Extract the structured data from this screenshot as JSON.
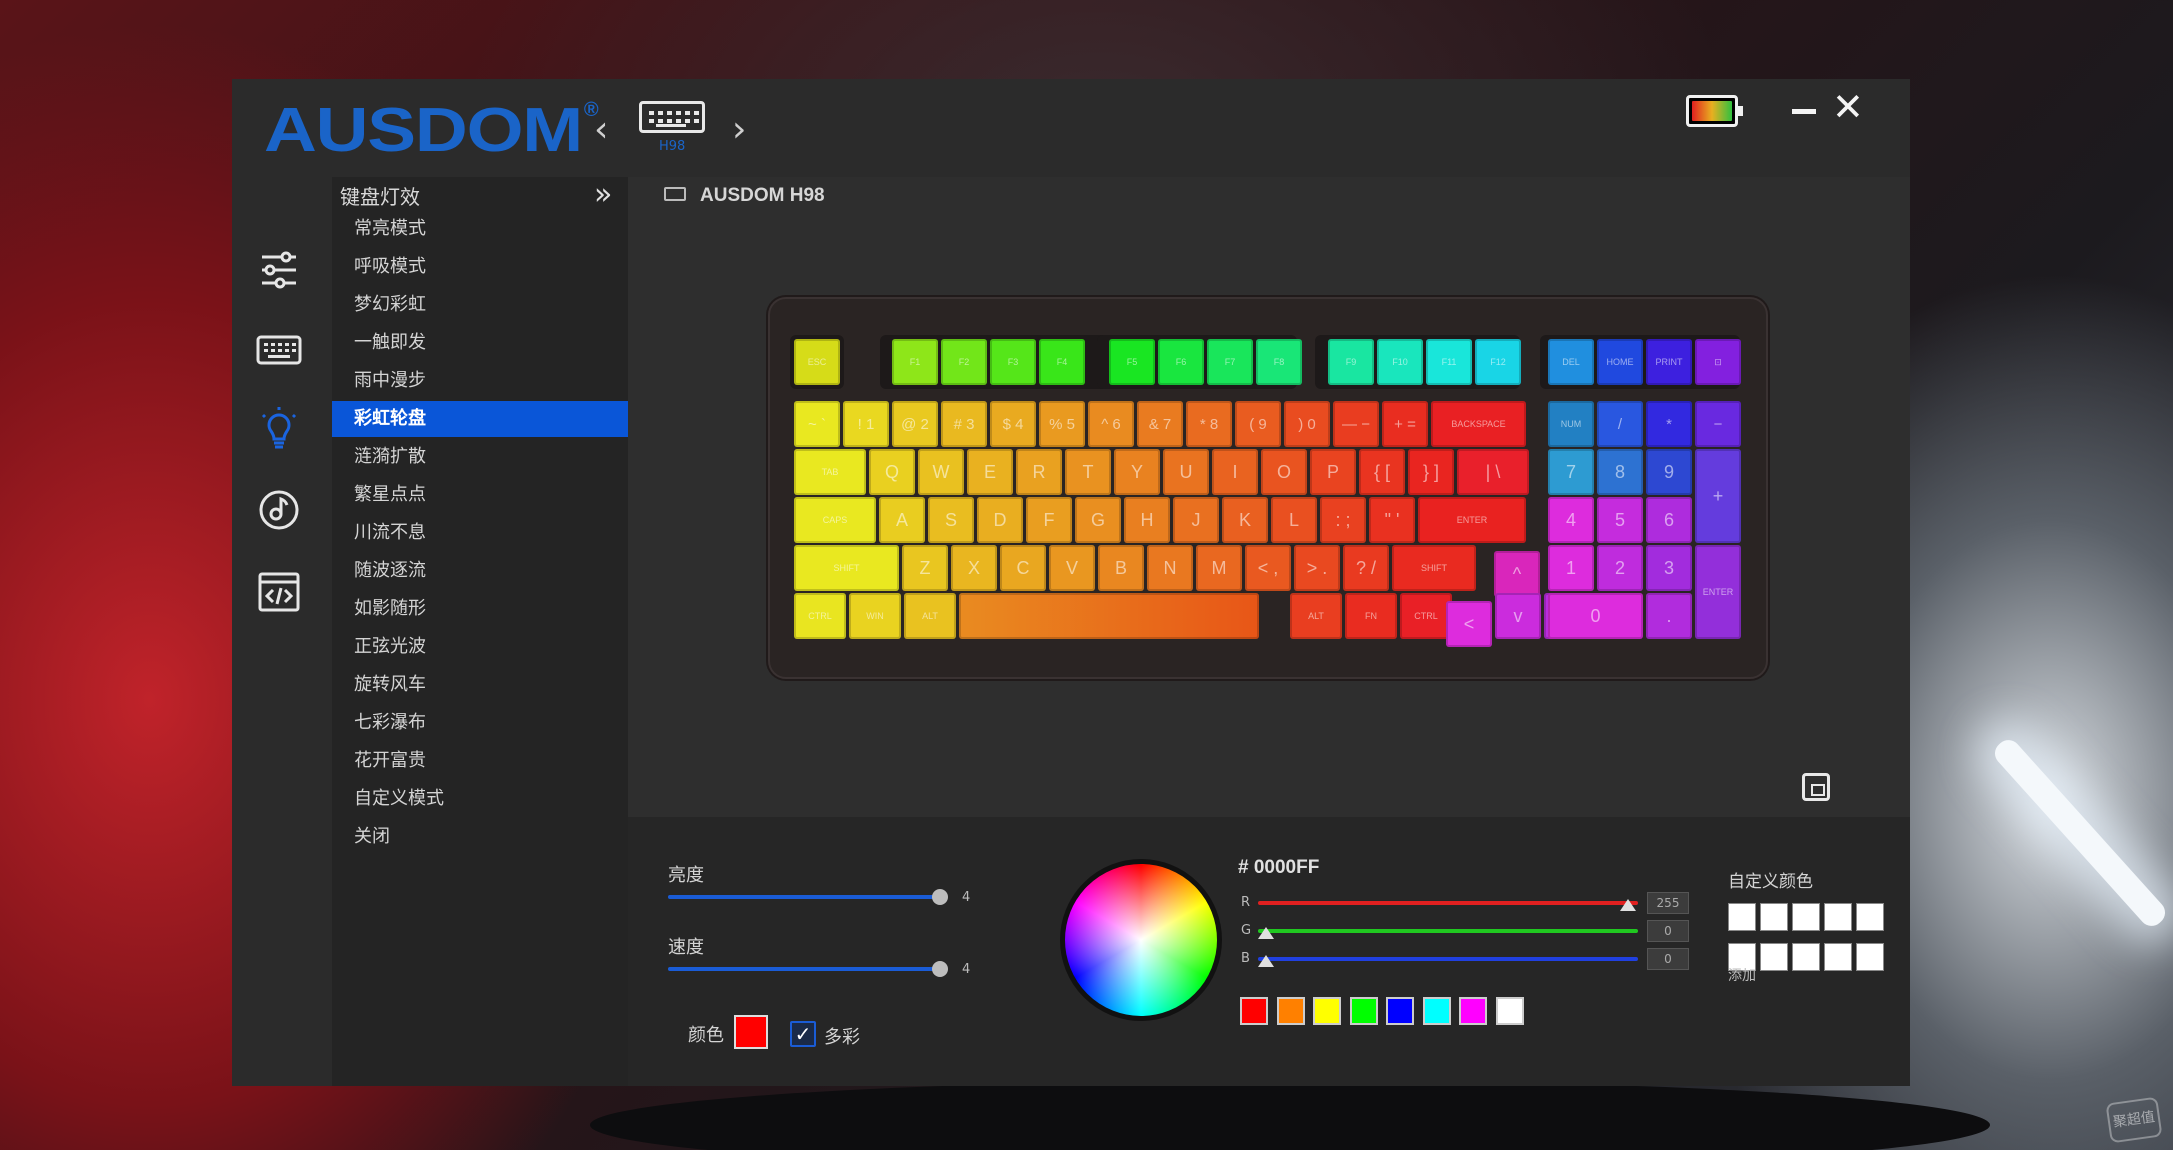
{
  "header": {
    "logo": "AUSDOM",
    "logo_mark": "®",
    "device_name": "H98",
    "prev_icon": "‹",
    "next_icon": "›",
    "minimize_label": "",
    "close_icon": "✕"
  },
  "sidebar_icons": [
    "sliders-icon",
    "keyboard-icon",
    "lightbulb-icon",
    "music-icon",
    "macro-code-icon"
  ],
  "menu": {
    "title": "键盘灯效",
    "collapse_icon": "»",
    "items": [
      {
        "label": "常亮模式"
      },
      {
        "label": "呼吸模式"
      },
      {
        "label": "梦幻彩虹"
      },
      {
        "label": "一触即发"
      },
      {
        "label": "雨中漫步"
      },
      {
        "label": "彩虹轮盘",
        "active": true
      },
      {
        "label": "涟漪扩散"
      },
      {
        "label": "繁星点点"
      },
      {
        "label": "川流不息"
      },
      {
        "label": "随波逐流"
      },
      {
        "label": "如影随形"
      },
      {
        "label": "正弦光波"
      },
      {
        "label": "旋转风车"
      },
      {
        "label": "七彩瀑布"
      },
      {
        "label": "花开富贵"
      },
      {
        "label": "自定义模式"
      },
      {
        "label": "关闭"
      }
    ]
  },
  "main": {
    "title": "AUSDOM H98"
  },
  "keyboard": {
    "row_f": [
      "ESC",
      "F1",
      "F2",
      "F3",
      "F4",
      "F5",
      "F6",
      "F7",
      "F8",
      "F9",
      "F10",
      "F11",
      "F12",
      "DEL",
      "HOME",
      "PRINT",
      "⊡"
    ],
    "row_1": [
      [
        "~",
        "`"
      ],
      [
        "!",
        "1"
      ],
      [
        "@",
        "2"
      ],
      [
        "#",
        "3"
      ],
      [
        "$",
        "4"
      ],
      [
        "%",
        "5"
      ],
      [
        "^",
        "6"
      ],
      [
        "&",
        "7"
      ],
      [
        "*",
        "8"
      ],
      [
        "(",
        "9"
      ],
      [
        ")",
        "0"
      ],
      [
        "—",
        "−"
      ],
      [
        "+",
        "="
      ],
      [
        "BACKSPACE",
        ""
      ],
      [
        "NUM",
        ""
      ],
      [
        "/",
        ""
      ],
      [
        "*",
        ""
      ],
      [
        "−",
        ""
      ]
    ],
    "row_2": [
      "TAB",
      "Q",
      "W",
      "E",
      "R",
      "T",
      "Y",
      "U",
      "I",
      "O",
      "P",
      "{ [",
      "} ]",
      "| \\",
      "7",
      "8",
      "9",
      "+"
    ],
    "row_3": [
      "CAPS",
      "A",
      "S",
      "D",
      "F",
      "G",
      "H",
      "J",
      "K",
      "L",
      ": ;",
      "\" '",
      "ENTER",
      "4",
      "5",
      "6"
    ],
    "row_4": [
      "SHIFT",
      "Z",
      "X",
      "C",
      "V",
      "B",
      "N",
      "M",
      "< ,",
      "> .",
      "? /",
      "SHIFT",
      "^",
      "1",
      "2",
      "3",
      "ENTER"
    ],
    "row_5": [
      "CTRL",
      "WIN",
      "ALT",
      "",
      "ALT",
      "FN",
      "CTRL",
      "<",
      "v",
      ">",
      "0",
      "."
    ]
  },
  "controls": {
    "brightness_label": "亮度",
    "brightness_value": "4",
    "speed_label": "速度",
    "speed_value": "4",
    "color_label": "颜色",
    "multicolor_label": "多彩",
    "multicolor_checked": true,
    "selected_color": "#FF0000",
    "hex_value": "# 0000FF",
    "r_label": "R",
    "r_value": "255",
    "g_label": "G",
    "g_value": "0",
    "b_label": "B",
    "b_value": "0",
    "swatches": [
      "#ff0000",
      "#ff8000",
      "#ffff00",
      "#00ff00",
      "#0000ff",
      "#00ffff",
      "#ff00ff",
      "#ffffff"
    ],
    "custom_colors_label": "自定义颜色",
    "add_label": "添加"
  },
  "watermark": "聚超值"
}
